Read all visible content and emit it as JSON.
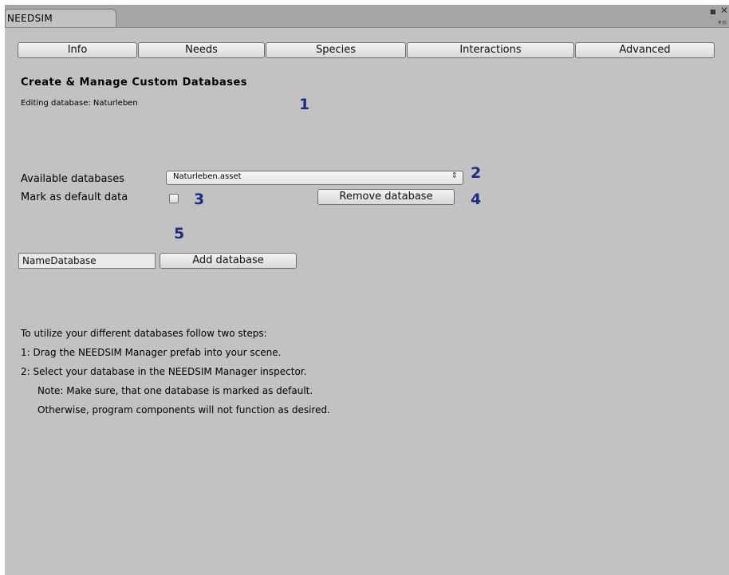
{
  "window": {
    "tab_title": "NEEDSIM",
    "maximize_glyph": "■",
    "close_glyph": "✕",
    "menu_glyph": "▾≡"
  },
  "toolbar": {
    "tabs": [
      {
        "label": "Info"
      },
      {
        "label": "Needs"
      },
      {
        "label": "Species"
      },
      {
        "label": "Interactions"
      },
      {
        "label": "Advanced"
      }
    ]
  },
  "header": {
    "title": "Create & Manage Custom Databases",
    "subtitle": "Editing database: Naturleben"
  },
  "markers": [
    "1",
    "2",
    "3",
    "4",
    "5"
  ],
  "databases": {
    "available_label": "Available databases",
    "selected": "Naturleben.asset",
    "select_arrow": "⇕",
    "default_label": "Mark as default data",
    "default_checked": false,
    "remove_label": "Remove database"
  },
  "add": {
    "input_value": "NameDatabase",
    "button_label": "Add database"
  },
  "instructions": [
    "To utilize your different databases follow two steps:",
    "1: Drag the NEEDSIM Manager prefab into your scene.",
    "2: Select your database in the NEEDSIM Manager inspector.",
    "Note: Make sure, that one database is marked as default.",
    "Otherwise, program components will not function as desired."
  ],
  "colors": {
    "panel_bg": "#c2c2c2",
    "tabbar_bg": "#a5a5a5",
    "marker": "#1d2f84"
  }
}
